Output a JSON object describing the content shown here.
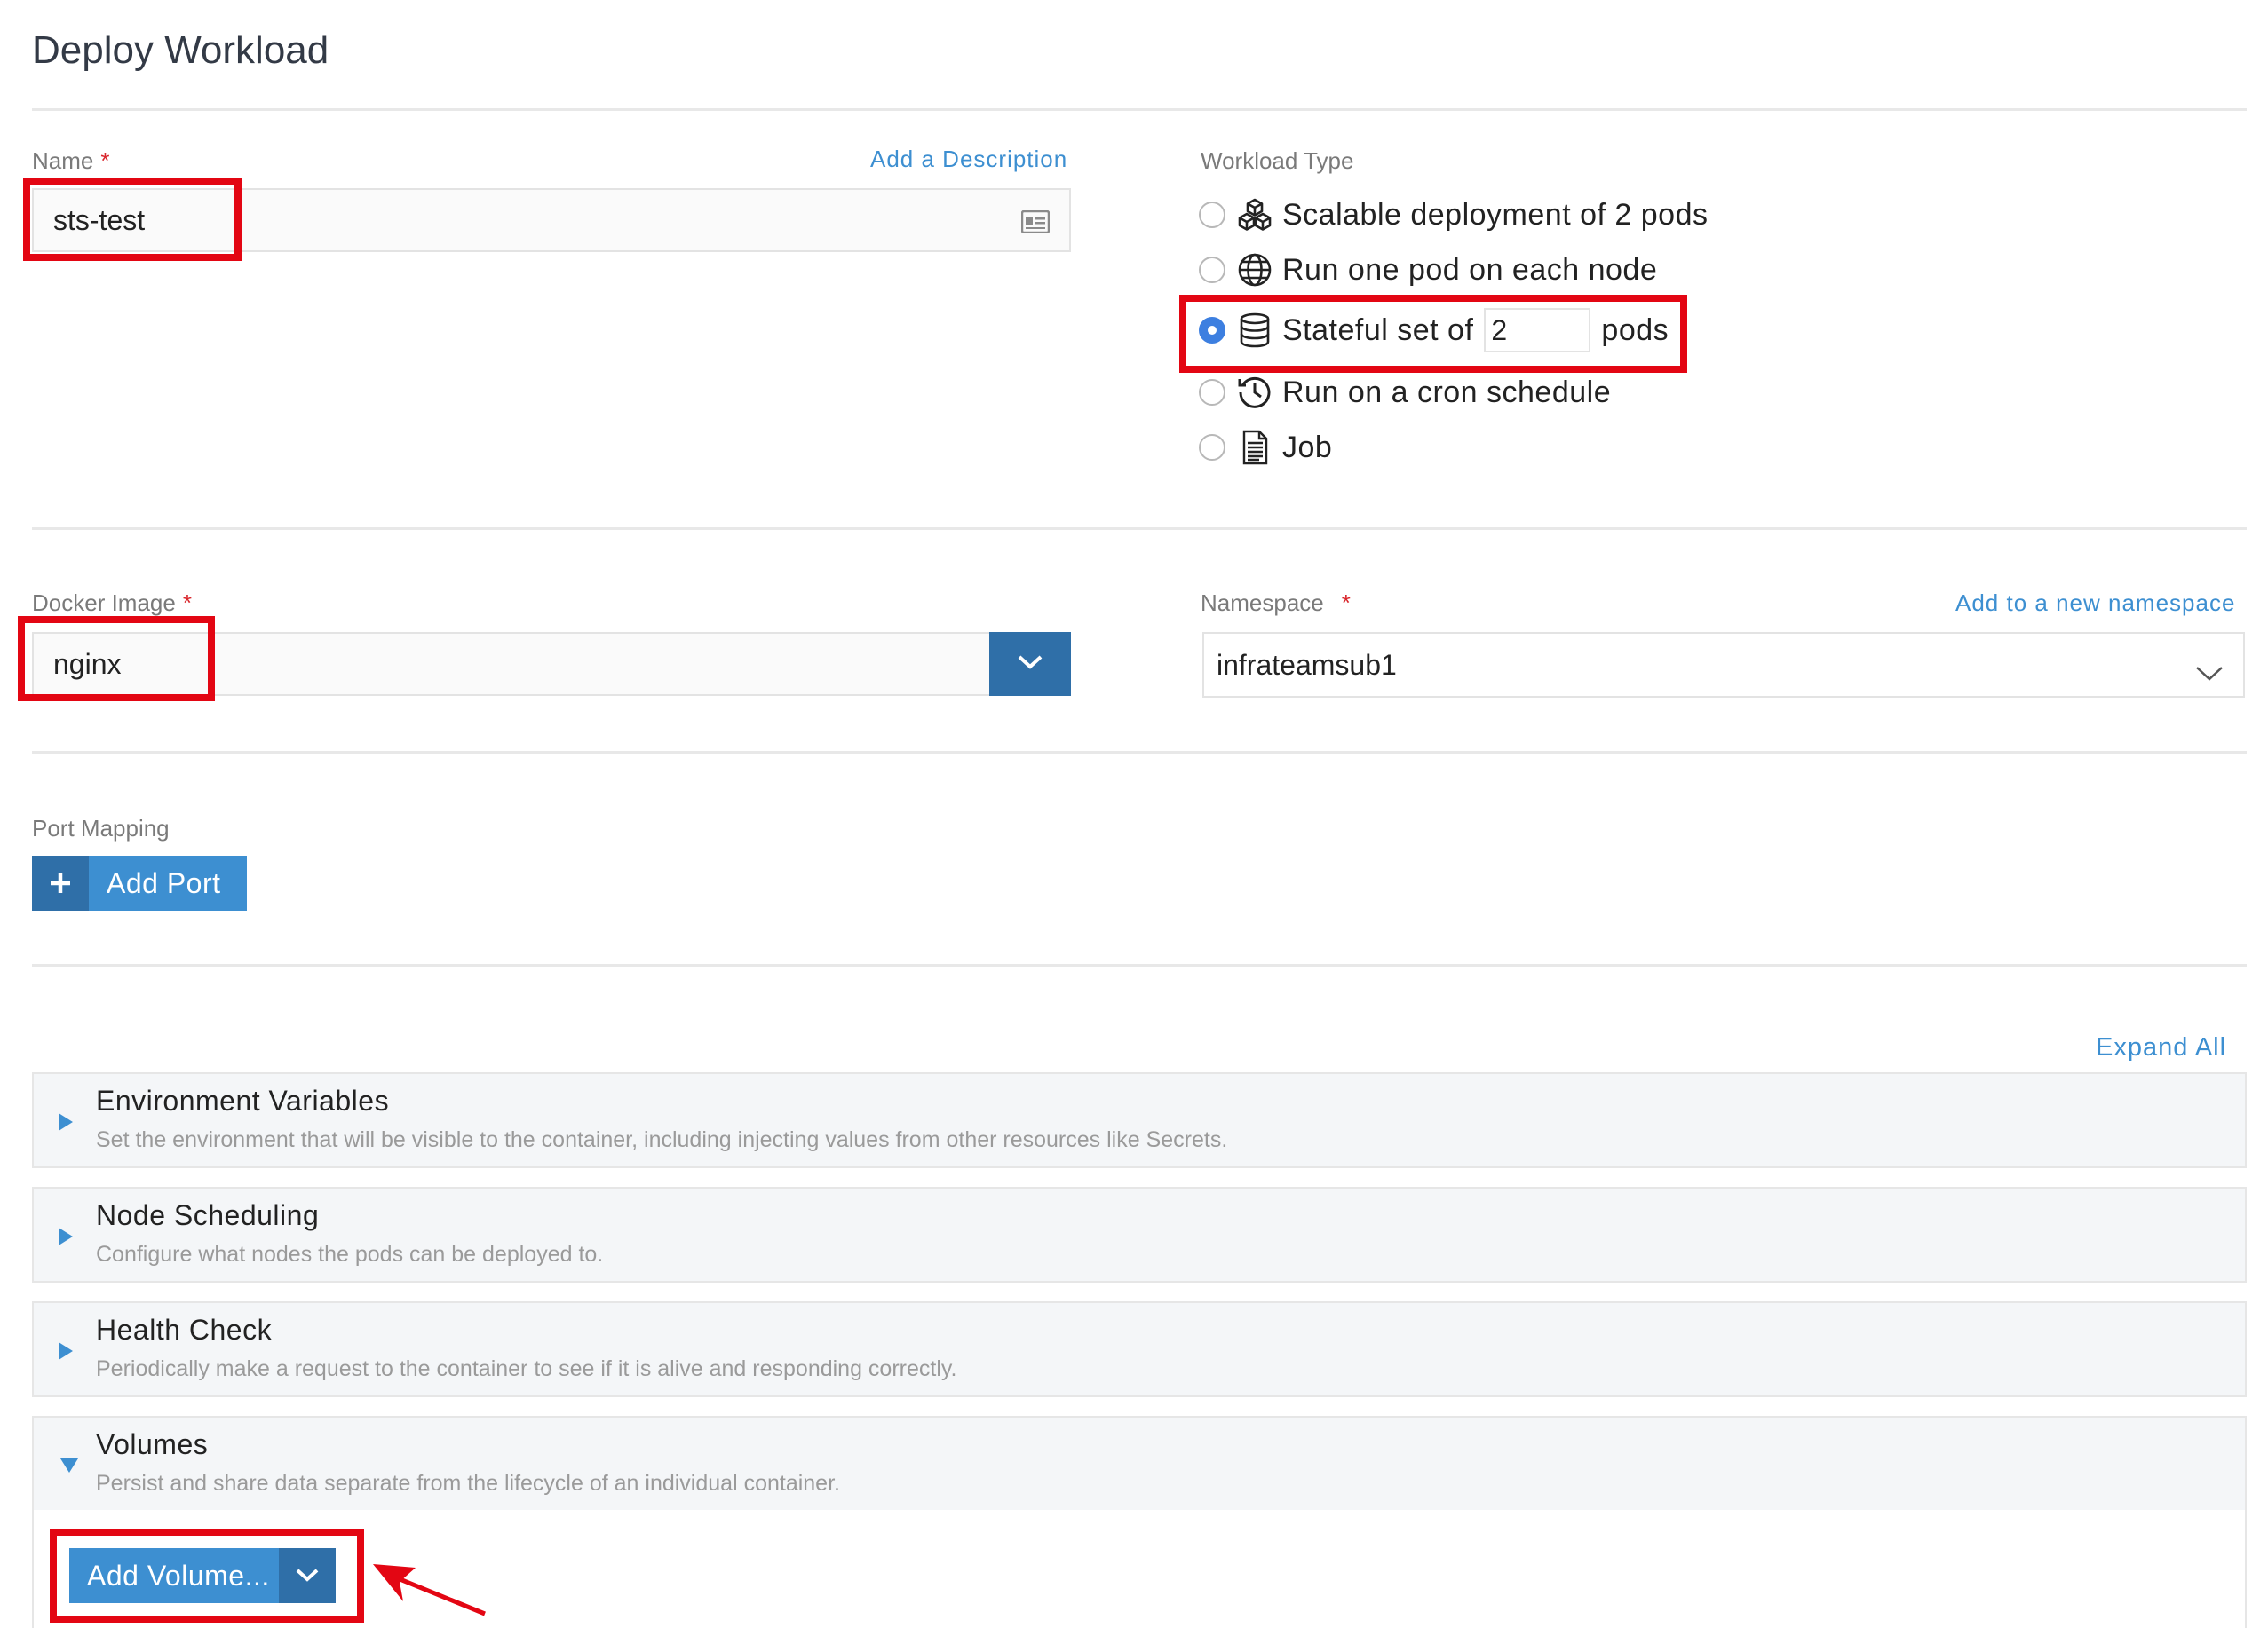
{
  "page": {
    "title": "Deploy Workload"
  },
  "name_field": {
    "label": "Name",
    "required_mark": "*",
    "value": "sts-test",
    "add_description_link": "Add a Description",
    "icon": "id-card-icon"
  },
  "workload_type": {
    "label": "Workload Type",
    "options": [
      {
        "label": "Scalable deployment of 2 pods",
        "icon": "cubes-icon",
        "selected": false
      },
      {
        "label": "Run one pod on each node",
        "icon": "globe-icon",
        "selected": false
      },
      {
        "label": "Stateful set of",
        "suffix": "pods",
        "count": "2",
        "icon": "database-icon",
        "selected": true
      },
      {
        "label": "Run on a cron schedule",
        "icon": "clock-icon",
        "selected": false
      },
      {
        "label": "Job",
        "icon": "document-icon",
        "selected": false
      }
    ]
  },
  "docker_image": {
    "label": "Docker Image",
    "required_mark": "*",
    "value": "nginx",
    "icon": "chevron-down-icon"
  },
  "namespace": {
    "label": "Namespace",
    "required_mark": "*",
    "value": "infrateamsub1",
    "add_link": "Add to a new namespace",
    "icon": "chevron-down-icon"
  },
  "port_mapping": {
    "label": "Port Mapping",
    "add_button": "Add Port",
    "icon": "plus-icon"
  },
  "expand_all": "Expand All",
  "sections": [
    {
      "title": "Environment Variables",
      "desc": "Set the environment that will be visible to the container, including injecting values from other resources like Secrets.",
      "expanded": false
    },
    {
      "title": "Node Scheduling",
      "desc": "Configure what nodes the pods can be deployed to.",
      "expanded": false
    },
    {
      "title": "Health Check",
      "desc": "Periodically make a request to the container to see if it is alive and responding correctly.",
      "expanded": false
    },
    {
      "title": "Volumes",
      "desc": "Persist and share data separate from the lifecycle of an individual container.",
      "expanded": true
    }
  ],
  "volumes": {
    "add_button": "Add Volume...",
    "icon": "chevron-down-icon"
  },
  "colors": {
    "accent": "#3d8fd1",
    "dark_accent": "#2f6fa8",
    "highlight": "#e30613",
    "required": "#d9262c"
  }
}
